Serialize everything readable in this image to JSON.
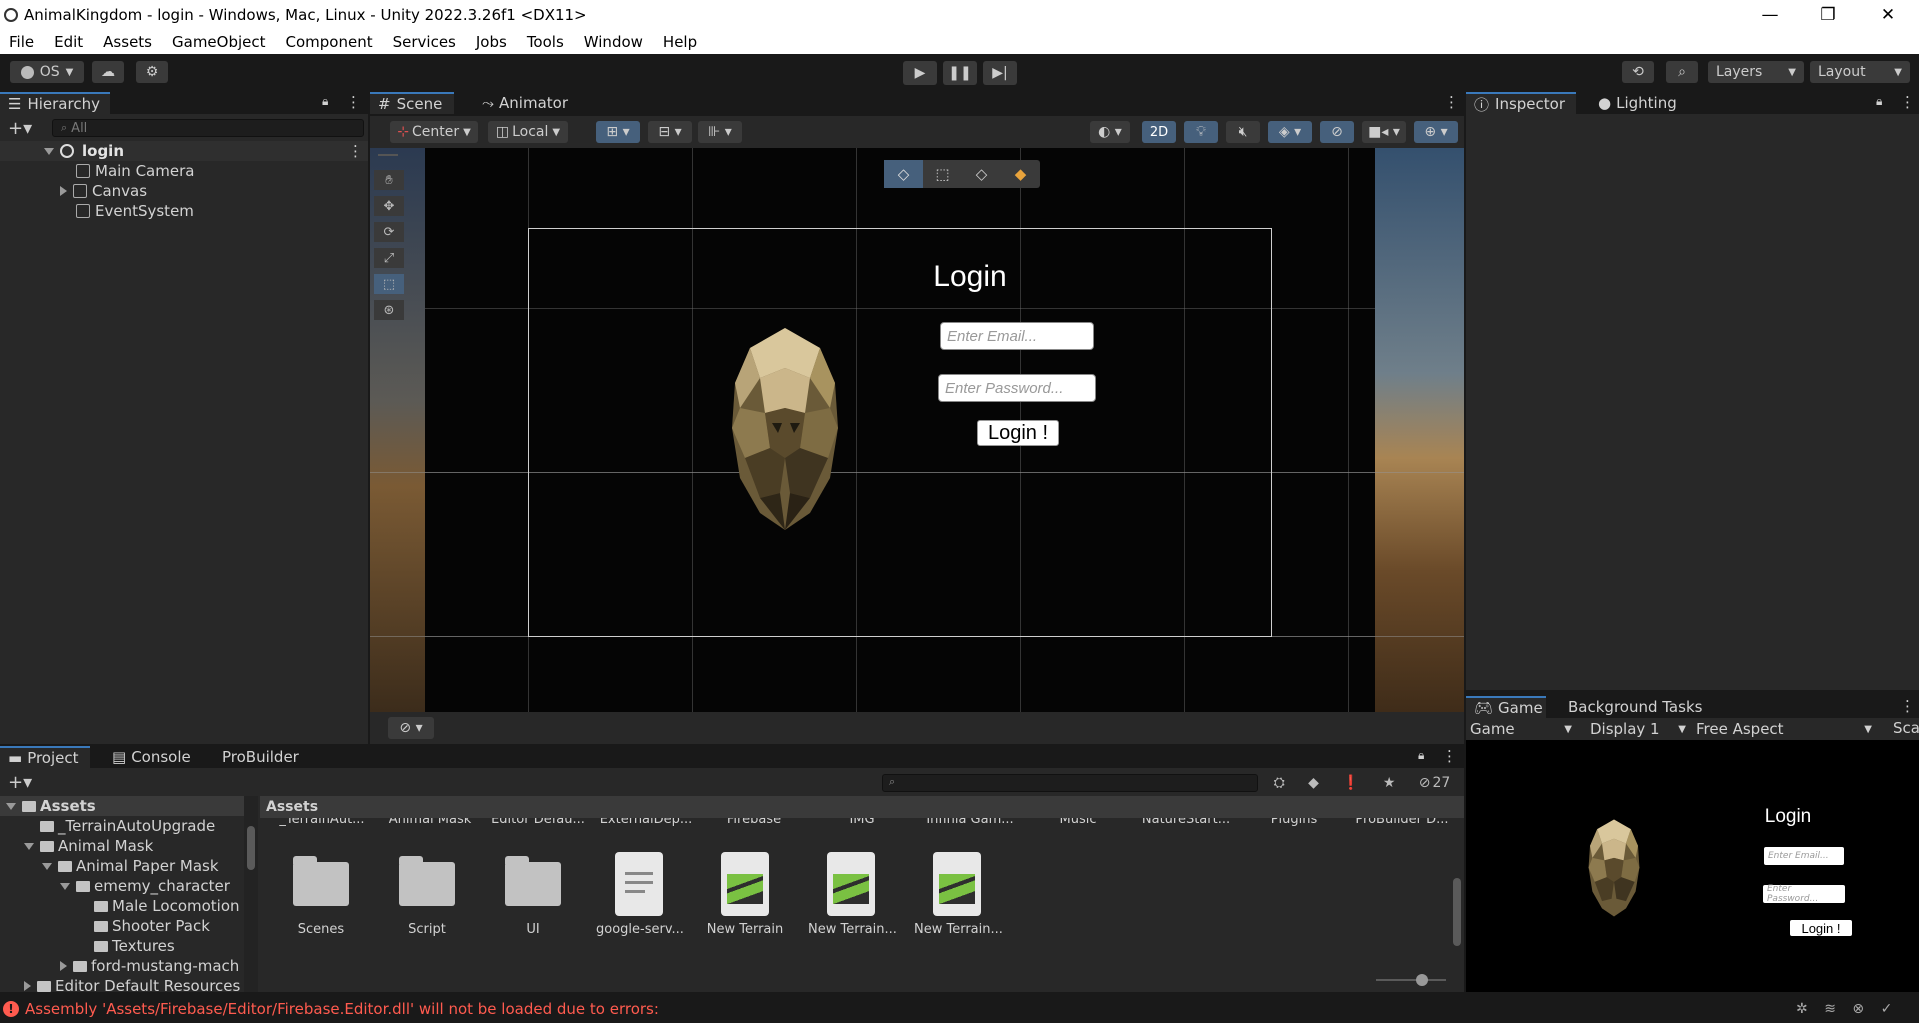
{
  "window": {
    "title": "AnimalKingdom - login - Windows, Mac, Linux - Unity 2022.3.26f1 <DX11>",
    "controls": [
      "—",
      "❐",
      "✕"
    ]
  },
  "menu": [
    "File",
    "Edit",
    "Assets",
    "GameObject",
    "Component",
    "Services",
    "Jobs",
    "Tools",
    "Window",
    "Help"
  ],
  "toolbar": {
    "account_label": "OS",
    "layers_label": "Layers",
    "layout_label": "Layout"
  },
  "hierarchy": {
    "tab_label": "Hierarchy",
    "search_placeholder": "All",
    "scene_name": "login",
    "items": [
      "Main Camera",
      "Canvas",
      "EventSystem"
    ]
  },
  "scene_view": {
    "tabs": [
      "Scene",
      "Animator"
    ],
    "pivot_label": "Center",
    "space_label": "Local",
    "mode_2d_label": "2D"
  },
  "login_ui": {
    "title": "Login",
    "email_placeholder": "Enter Email...",
    "password_placeholder": "Enter Password...",
    "button_label": "Login !"
  },
  "inspector": {
    "tabs": [
      "Inspector",
      "Lighting"
    ]
  },
  "game_view": {
    "tabs": [
      "Game",
      "Background Tasks"
    ],
    "mode_label": "Game",
    "display_label": "Display 1",
    "aspect_label": "Free Aspect",
    "scale_label": "Sca"
  },
  "project": {
    "tabs": [
      "Project",
      "Console",
      "ProBuilder"
    ],
    "hidden_count": "27",
    "breadcrumb": "Assets",
    "tree": [
      {
        "label": "Assets",
        "indent": 0,
        "arrow": "down"
      },
      {
        "label": "_TerrainAutoUpgrade",
        "indent": 1,
        "arrow": "none"
      },
      {
        "label": "Animal Mask",
        "indent": 1,
        "arrow": "down"
      },
      {
        "label": "Animal Paper Mask",
        "indent": 2,
        "arrow": "down"
      },
      {
        "label": "ememy_character",
        "indent": 3,
        "arrow": "down"
      },
      {
        "label": "Male Locomotion",
        "indent": 4,
        "arrow": "none"
      },
      {
        "label": "Shooter Pack",
        "indent": 4,
        "arrow": "none"
      },
      {
        "label": "Textures",
        "indent": 4,
        "arrow": "none"
      },
      {
        "label": "ford-mustang-mach",
        "indent": 3,
        "arrow": "right"
      },
      {
        "label": "Editor Default Resources",
        "indent": 1,
        "arrow": "right"
      }
    ],
    "top_row_labels": [
      "_TerrainAut...",
      "Animal Mask",
      "Editor Defau...",
      "ExternalDep...",
      "Firebase",
      "IMG",
      "Infinia Gam...",
      "Music",
      "NatureStart...",
      "Plugins",
      "ProBuilder D..."
    ],
    "assets": [
      {
        "label": "Scenes",
        "kind": "folder"
      },
      {
        "label": "Script",
        "kind": "folder"
      },
      {
        "label": "UI",
        "kind": "folder"
      },
      {
        "label": "google-serv...",
        "kind": "file"
      },
      {
        "label": "New Terrain",
        "kind": "terrain"
      },
      {
        "label": "New Terrain...",
        "kind": "terrain"
      },
      {
        "label": "New Terrain...",
        "kind": "terrain"
      }
    ]
  },
  "status": {
    "error_message": "Assembly 'Assets/Firebase/Editor/Firebase.Editor.dll' will not be loaded due to errors:"
  },
  "colors": {
    "accent": "#3a79bb",
    "error": "#ff5b4f",
    "panel": "#282828",
    "background": "#191919"
  }
}
